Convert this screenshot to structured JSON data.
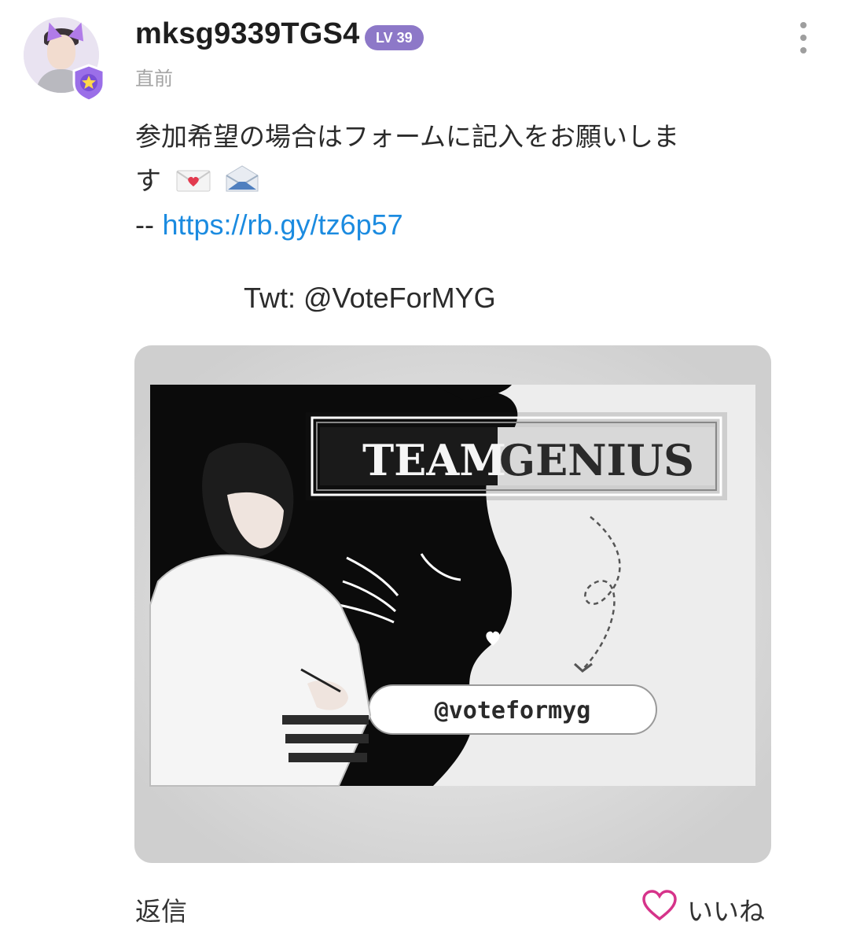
{
  "post": {
    "username": "mksg9339TGS4",
    "level": "LV 39",
    "time": "直前",
    "text_line1": "参加希望の場合はフォームに記入をお願いしま",
    "text_line2": "す",
    "dash": "--",
    "link": "https://rb.gy/tz6p57",
    "twt": "Twt: @VoteForMYG"
  },
  "image": {
    "title_word1": "TEAM",
    "title_word2": "GENIUS",
    "handle": "@voteformyg"
  },
  "actions": {
    "reply": "返信",
    "like": "いいね"
  },
  "colors": {
    "accent_purple": "#8d78c8",
    "link_blue": "#1b8be0",
    "like_pink": "#d6338a"
  },
  "icons": [
    "more-vertical-icon",
    "heart-icon",
    "level-shield-icon",
    "love-letter-emoji",
    "envelope-emoji"
  ]
}
